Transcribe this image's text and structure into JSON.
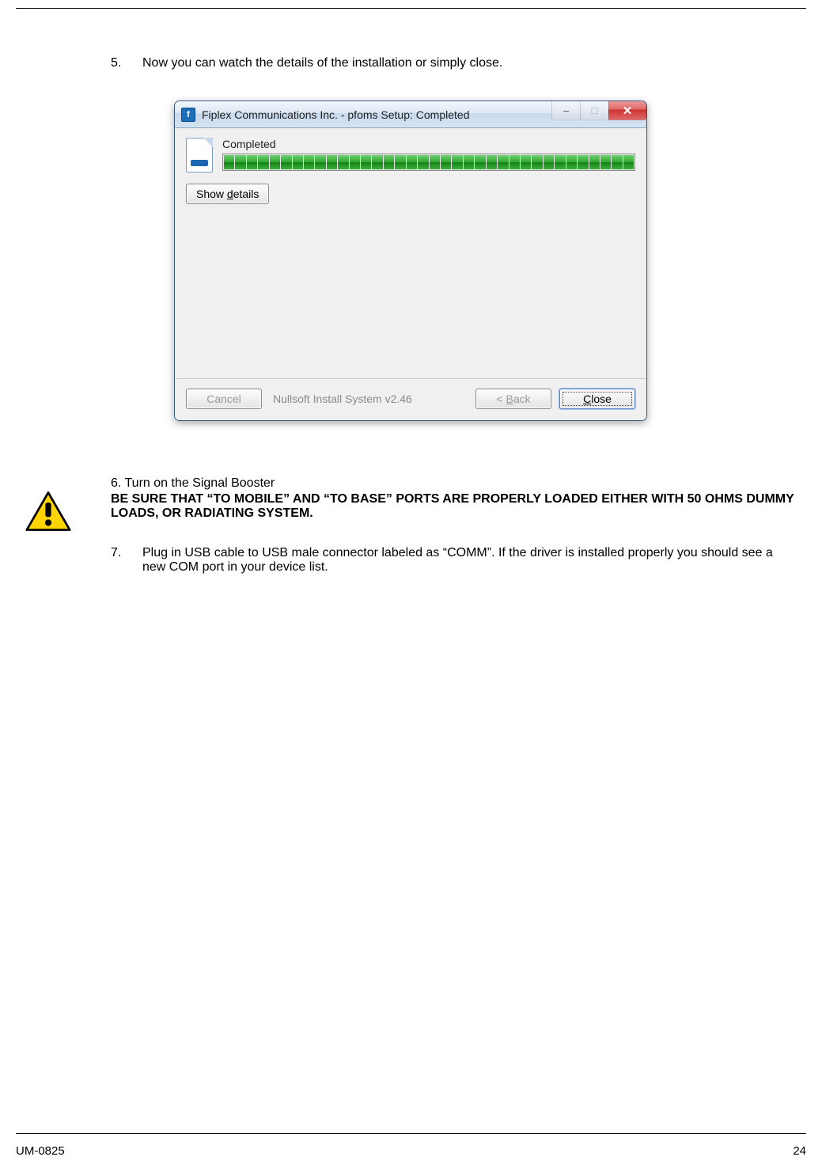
{
  "steps": {
    "s5": {
      "num": "5.",
      "text": "Now you can watch the details of the installation or simply close."
    },
    "s6": {
      "title": "6. Turn on the Signal Booster",
      "bold": "BE SURE THAT “TO MOBILE” AND “TO BASE” PORTS ARE PROPERLY LOADED EITHER WITH 50 OHMS DUMMY LOADS, OR RADIATING SYSTEM."
    },
    "s7": {
      "num": "7.",
      "text": "Plug in USB cable to USB male connector labeled as “COMM”. If the driver is installed properly you should see a new COM port in your device list."
    }
  },
  "dialog": {
    "title": "Fiplex Communications Inc. - pfoms Setup: Completed",
    "appicon_text": "f",
    "completed_label": "Completed",
    "show_details_pre": "Show ",
    "show_details_u": "d",
    "show_details_post": "etails",
    "cancel_label": "Cancel",
    "installer_label": "Nullsoft Install System v2.46",
    "back_pre": "< ",
    "back_u": "B",
    "back_post": "ack",
    "close_u": "C",
    "close_post": "lose",
    "progress_segments": 36,
    "win": {
      "min": "–",
      "max": "□",
      "close": "✕"
    }
  },
  "footer": {
    "doc_id": "UM-0825",
    "page_number": "24"
  },
  "icons": {
    "warning_name": "warning-triangle-icon",
    "app_name": "app-icon"
  }
}
